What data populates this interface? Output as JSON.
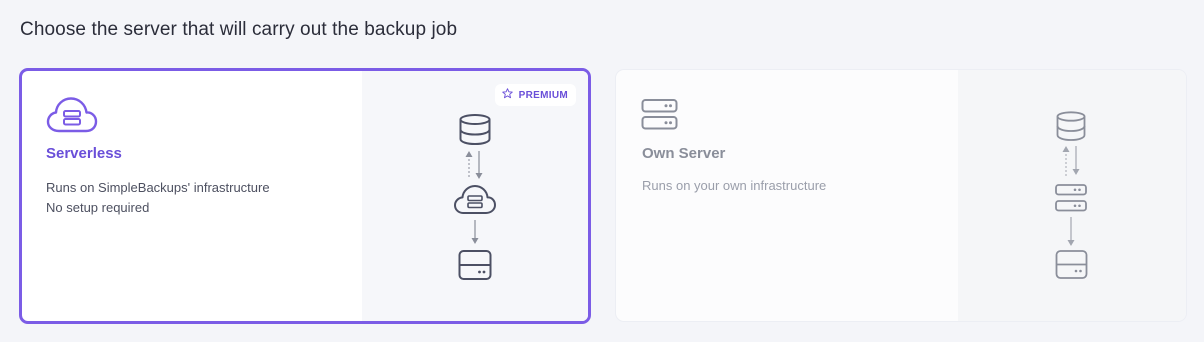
{
  "page": {
    "heading": "Choose the server that will carry out the backup job"
  },
  "options": [
    {
      "title": "Serverless",
      "description_lines": [
        "Runs on SimpleBackups' infrastructure",
        "No setup required"
      ],
      "badge": "PREMIUM",
      "selected": true,
      "icon": "cloud-server-icon",
      "diagram": [
        "database-icon",
        "cloud-server-icon",
        "storage-drive-icon"
      ]
    },
    {
      "title": "Own Server",
      "description_lines": [
        "Runs on your own infrastructure"
      ],
      "selected": false,
      "icon": "server-stack-icon",
      "diagram": [
        "database-icon",
        "server-stack-icon",
        "storage-drive-icon"
      ]
    }
  ],
  "colors": {
    "accent": "#7b5ce6",
    "muted": "#8a8e9a",
    "background": "#f4f5f9"
  }
}
